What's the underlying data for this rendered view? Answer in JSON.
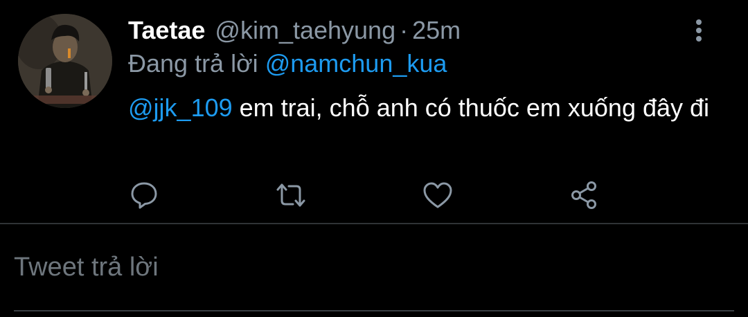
{
  "tweet": {
    "display_name": "Taetae",
    "handle": "@kim_taehyung",
    "separator": "·",
    "time": "25m",
    "replying_prefix": "Đang trả lời",
    "replying_to": "@namchun_kua",
    "mention": "@jjk_109",
    "text": " em trai, chỗ anh có thuốc em xuống đây đi",
    "avatar": "user-avatar"
  },
  "actions": {
    "reply_icon": "speech-bubble-icon",
    "retweet_icon": "retweet-icon",
    "like_icon": "heart-icon",
    "share_icon": "share-icon",
    "more_icon": "vertical-dots-icon"
  },
  "composer": {
    "placeholder": "Tweet trả lời"
  },
  "colors": {
    "background": "#000000",
    "link": "#1d9bf0",
    "secondary_text": "#8b98a5",
    "icon": "#8b98a5",
    "divider": "#2f3336"
  }
}
